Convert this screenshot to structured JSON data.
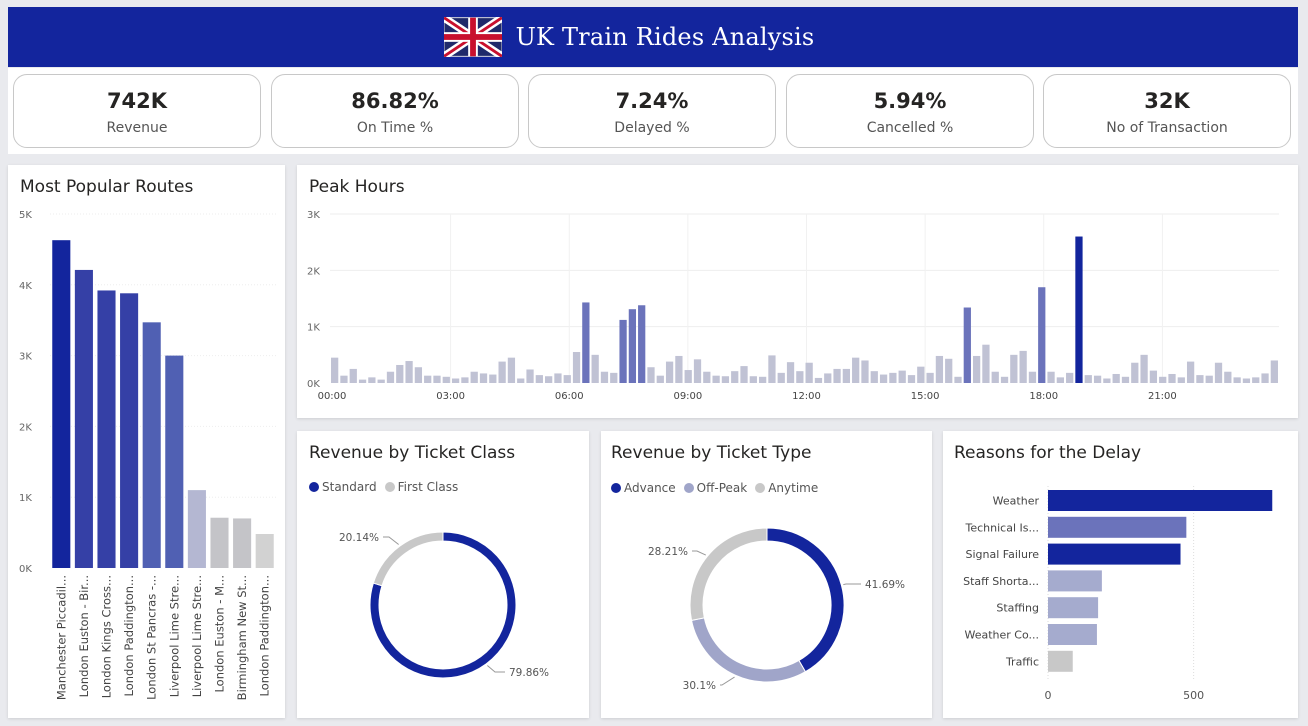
{
  "header": {
    "title": "UK Train Rides Analysis"
  },
  "kpis": [
    {
      "value": "742K",
      "label": "Revenue"
    },
    {
      "value": "86.82%",
      "label": "On Time %"
    },
    {
      "value": "7.24%",
      "label": "Delayed %"
    },
    {
      "value": "5.94%",
      "label": "Cancelled %"
    },
    {
      "value": "32K",
      "label": "No of Transaction"
    }
  ],
  "colors": {
    "navy": "#13259d",
    "blue2": "#3540a6",
    "blue3": "#5060b3",
    "periwinkle": "#6b73bb",
    "lavender": "#a5abce",
    "grey": "#c8c8c8"
  },
  "panels": {
    "routes": "Most Popular Routes",
    "peak": "Peak Hours",
    "ticket_class": "Revenue by Ticket Class",
    "ticket_type": "Revenue by Ticket Type",
    "delay": "Reasons for the Delay"
  },
  "legends": {
    "ticket_class": [
      "Standard",
      "First Class"
    ],
    "ticket_type": [
      "Advance",
      "Off-Peak",
      "Anytime"
    ]
  },
  "chart_data": [
    {
      "id": "routes",
      "type": "bar",
      "title": "Most Popular Routes",
      "categories": [
        "Manchester Piccadil...",
        "London Euston - Bir...",
        "London Kings Cross...",
        "London Paddington...",
        "London St Pancras -...",
        "Liverpool Lime Stre...",
        "Liverpool Lime Stre...",
        "London Euston - M...",
        "Birmingham New St...",
        "London Paddington..."
      ],
      "values": [
        4630,
        4210,
        3920,
        3880,
        3470,
        3000,
        1100,
        710,
        700,
        480
      ],
      "colors": [
        "#13259d",
        "#3540a6",
        "#3540a6",
        "#3540a6",
        "#5060b3",
        "#5060b3",
        "#b4b7d2",
        "#c4c4c8",
        "#c4c4c8",
        "#d2d2d2"
      ],
      "yticks": [
        "0K",
        "1K",
        "2K",
        "3K",
        "4K",
        "5K"
      ],
      "ylim": [
        0,
        5000
      ]
    },
    {
      "id": "peak",
      "type": "bar",
      "title": "Peak Hours",
      "xticks": [
        "00:00",
        "03:00",
        "06:00",
        "09:00",
        "12:00",
        "15:00",
        "18:00",
        "21:00"
      ],
      "yticks": [
        "0K",
        "1K",
        "2K",
        "3K"
      ],
      "ylim": [
        0,
        3000
      ],
      "values": [
        450,
        130,
        250,
        60,
        100,
        60,
        200,
        320,
        390,
        280,
        130,
        130,
        110,
        80,
        100,
        200,
        170,
        150,
        380,
        450,
        80,
        240,
        140,
        120,
        170,
        140,
        550,
        1430,
        500,
        200,
        180,
        1120,
        1310,
        1380,
        280,
        130,
        380,
        480,
        230,
        420,
        200,
        130,
        120,
        210,
        300,
        120,
        110,
        490,
        180,
        370,
        210,
        360,
        90,
        170,
        250,
        250,
        450,
        400,
        210,
        150,
        180,
        220,
        140,
        290,
        180,
        480,
        430,
        110,
        1340,
        480,
        680,
        200,
        110,
        500,
        570,
        200,
        1700,
        200,
        100,
        180,
        2600,
        140,
        130,
        80,
        160,
        110,
        360,
        500,
        220,
        110,
        160,
        100,
        380,
        140,
        130,
        360,
        200,
        100,
        80,
        100,
        170,
        400
      ],
      "highlight_threshold": 1000
    },
    {
      "id": "ticket_class",
      "type": "pie",
      "title": "Revenue by Ticket Class",
      "labels": [
        "Standard",
        "First Class"
      ],
      "values": [
        79.86,
        20.14
      ],
      "display": [
        "79.86%",
        "20.14%"
      ],
      "colors": [
        "#13259d",
        "#c8c8c8"
      ]
    },
    {
      "id": "ticket_type",
      "type": "pie",
      "title": "Revenue by Ticket Type",
      "labels": [
        "Advance",
        "Off-Peak",
        "Anytime"
      ],
      "values": [
        41.69,
        30.1,
        28.21
      ],
      "display": [
        "41.69%",
        "30.1%",
        "28.21%"
      ],
      "colors": [
        "#13259d",
        "#a0a5c9",
        "#c8c8c8"
      ]
    },
    {
      "id": "delay",
      "type": "bar",
      "orientation": "horizontal",
      "title": "Reasons for the Delay",
      "categories": [
        "Weather",
        "Technical Is...",
        "Signal Failure",
        "Staff Shorta...",
        "Staffing",
        "Weather Co...",
        "Traffic"
      ],
      "values": [
        770,
        475,
        455,
        185,
        172,
        168,
        85
      ],
      "colors": [
        "#13259d",
        "#6b73bb",
        "#13259d",
        "#a5abce",
        "#a5abce",
        "#a5abce",
        "#c8c8c8"
      ],
      "xticks": [
        "0",
        "500"
      ],
      "xlim": [
        0,
        800
      ]
    }
  ]
}
